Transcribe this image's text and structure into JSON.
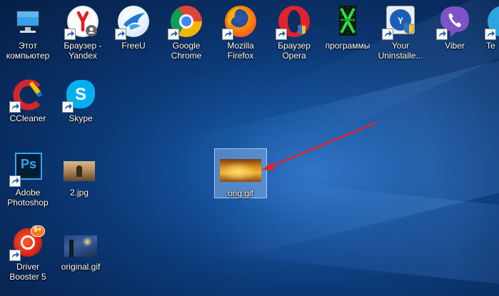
{
  "desktop": {
    "icons": [
      {
        "label": "Этот\nкомпьютер",
        "icon": "this-pc-icon"
      },
      {
        "label": "Браузер -\nYandex",
        "icon": "yandex-browser-icon"
      },
      {
        "label": "FreeU",
        "icon": "freeu-icon"
      },
      {
        "label": "Google\nChrome",
        "icon": "chrome-icon"
      },
      {
        "label": "Mozilla\nFirefox",
        "icon": "firefox-icon"
      },
      {
        "label": "Браузер\nOpera",
        "icon": "opera-icon"
      },
      {
        "label": "программы",
        "icon": "programs-folder-icon"
      },
      {
        "label": "Your\nUninstalle...",
        "icon": "your-uninstaller-icon"
      },
      {
        "label": "Viber",
        "icon": "viber-icon"
      },
      {
        "label": "Te",
        "icon": "telegram-icon"
      },
      {
        "label": "CCleaner",
        "icon": "ccleaner-icon"
      },
      {
        "label": "Skype",
        "icon": "skype-icon"
      },
      {
        "label": "Adobe\nPhotoshop",
        "icon": "photoshop-icon"
      },
      {
        "label": "2.jpg",
        "icon": "image-thumbnail-icon"
      },
      {
        "label": "orig.gif",
        "icon": "gif-thumbnail-icon"
      },
      {
        "label": "Driver\nBooster 5",
        "icon": "driver-booster-icon"
      },
      {
        "label": "original.gif",
        "icon": "gif-thumbnail-icon"
      }
    ],
    "badges": {
      "photoshop": "Ps",
      "driver_booster": "9+"
    },
    "annotation": {
      "type": "arrow",
      "color": "#e0242a",
      "points_to": "orig.gif"
    },
    "colors": {
      "wallpaper": "#0c3a78",
      "selection": "#96bef0"
    }
  }
}
